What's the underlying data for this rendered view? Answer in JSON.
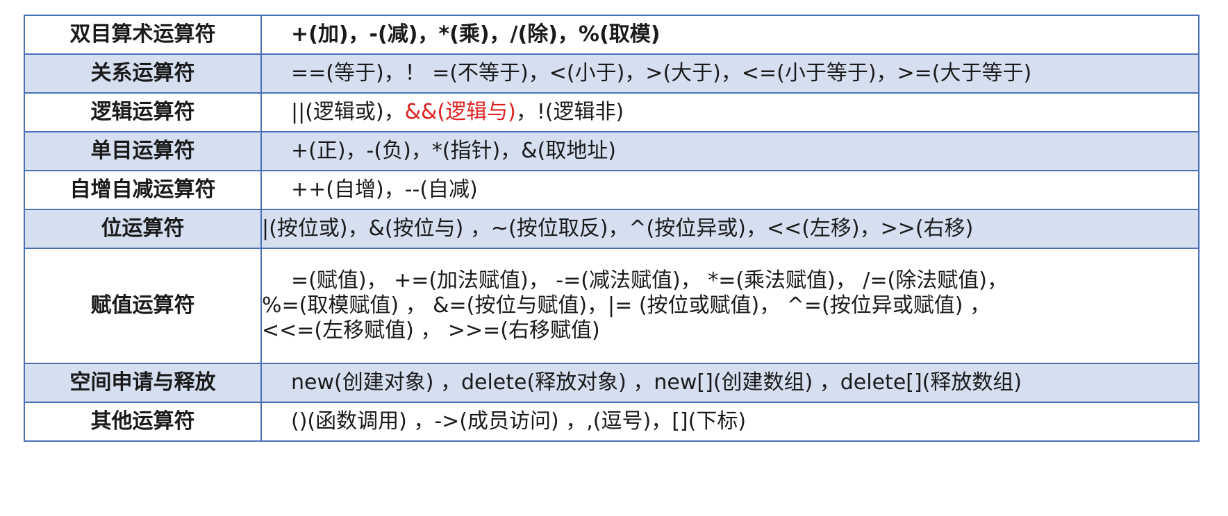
{
  "accent_color": "#e02020",
  "border_color": "#4a70b8",
  "shade_color": "#d6dff0",
  "rows": [
    {
      "category": "双目算术运算符",
      "operators": "+(加)，-(减)，*(乘)，/(除)，%(取模)"
    },
    {
      "category": "关系运算符",
      "operators": "==(等于)，！ =(不等于)，<(小于)，>(大于)，<=(小于等于)，>=(大于等于)"
    },
    {
      "category": "逻辑运算符",
      "operators_before": "||(逻辑或)，",
      "operators_highlight": "&&(逻辑与)",
      "operators_after": "，!(逻辑非)"
    },
    {
      "category": "单目运算符",
      "operators": "+(正)，-(负)，*(指针)，&(取地址)"
    },
    {
      "category": "自增自减运算符",
      "operators": "++(自增)，--(自减)"
    },
    {
      "category": "位运算符",
      "operators": "|(按位或)，&(按位与) ，~(按位取反)，^(按位异或)，<<(左移)，>>(右移)"
    },
    {
      "category": "赋值运算符",
      "operators_lines": [
        "=(赋值)， +=(加法赋值)， -=(减法赋值)， *=(乘法赋值)， /=(除法赋值)，",
        "%=(取模赋值) ， &=(按位与赋值)，|= (按位或赋值)， ^=(按位异或赋值) ，",
        "<<=(左移赋值) ， >>=(右移赋值)"
      ]
    },
    {
      "category": "空间申请与释放",
      "operators": "new(创建对象) ，delete(释放对象) ，new[](创建数组) ，delete[](释放数组)"
    },
    {
      "category": "其他运算符",
      "operators": "()(函数调用) ，->(成员访问) ，,(逗号)，[](下标)"
    }
  ]
}
